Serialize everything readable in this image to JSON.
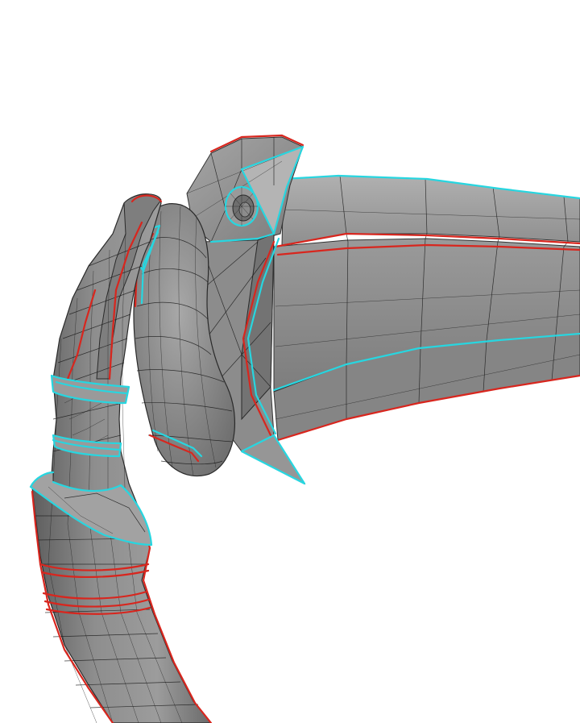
{
  "viewport": {
    "background": "#ffffff"
  },
  "model": {
    "base_color": "#8a8a8a",
    "light_color": "#a9a9a9",
    "shadow_color": "#6a6a6a",
    "wire_color": "#1c1c1c",
    "seam_colors": {
      "primary": "#d8261e",
      "secondary": "#27d6e0"
    }
  }
}
